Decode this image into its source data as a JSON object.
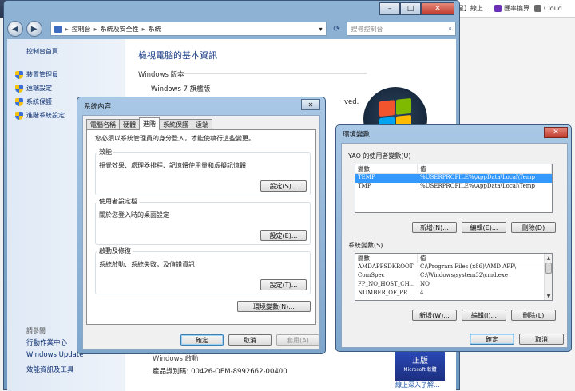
{
  "browser": {
    "bookmarks": [
      {
        "label": "星】線上…",
        "color": "#e05a1f"
      },
      {
        "label": "匯率換算",
        "color": "#6a2fb4"
      },
      {
        "label": "Cloud",
        "color": "#6a6a6a"
      }
    ]
  },
  "control_panel": {
    "breadcrumbs": [
      "控制台",
      "系統及安全性",
      "系統"
    ],
    "search_placeholder": "搜尋控制台",
    "sidebar": {
      "home": "控制台首頁",
      "items": [
        "裝置管理員",
        "遠端設定",
        "系統保護",
        "進階系統設定"
      ],
      "see_also_title": "請參閱",
      "see_also": [
        "行動作業中心",
        "Windows Update",
        "效能資訊及工具"
      ]
    },
    "main": {
      "title": "檢視電腦的基本資訊",
      "edition_heading": "Windows 版本",
      "edition": "Windows 7 旗艦版",
      "copyright_tail": "ved.",
      "activation_heading": "Windows 啟動",
      "product_id": "產品識別碼: 00426-OEM-8992662-00400",
      "genuine_label": "正版",
      "genuine_sub": "Microsoft 軟體",
      "genuine_link": "線上深入了解..."
    },
    "caption": {
      "minimize": "–",
      "maximize": "□",
      "close": "✕"
    }
  },
  "system_properties": {
    "title": "系統內容",
    "close": "✕",
    "tabs": [
      "電腦名稱",
      "硬體",
      "進階",
      "系統保護",
      "遠端"
    ],
    "active_tab": 2,
    "note": "您必須以系統管理員的身分登入，才能使執行這些變更。",
    "groups": [
      {
        "title": "效能",
        "text": "視覺效果、處理器排程、記憶體使用量和虛擬記憶體",
        "button": "設定(S)..."
      },
      {
        "title": "使用者設定檔",
        "text": "關於您登入時的桌面設定",
        "button": "設定(E)..."
      },
      {
        "title": "啟動及修復",
        "text": "系統啟動、系統失敗，及偵錯資訊",
        "button": "設定(T)..."
      }
    ],
    "env_button": "環境變數(N)...",
    "ok": "確定",
    "cancel": "取消",
    "apply": "套用(A)"
  },
  "env_vars": {
    "title": "環境變數",
    "close": "✕",
    "user_label": "YAO 的使用者變數(U)",
    "col_var": "變數",
    "col_val": "值",
    "user_rows": [
      {
        "name": "TEMP",
        "value": "%USERPROFILE%\\AppData\\Local\\Temp",
        "selected": true
      },
      {
        "name": "TMP",
        "value": "%USERPROFILE%\\AppData\\Local\\Temp",
        "selected": false
      }
    ],
    "user_buttons": [
      "新增(N)...",
      "編輯(E)...",
      "刪除(D)"
    ],
    "system_label": "系統變數(S)",
    "system_rows": [
      {
        "name": "AMDAPPSDKROOT",
        "value": "C:\\Program Files (x86)\\AMD APP\\"
      },
      {
        "name": "ComSpec",
        "value": "C:\\Windows\\system32\\cmd.exe"
      },
      {
        "name": "FP_NO_HOST_CH...",
        "value": "NO"
      },
      {
        "name": "NUMBER_OF_PR...",
        "value": "4"
      }
    ],
    "system_buttons": [
      "新增(W)...",
      "編輯(I)...",
      "刪除(L)"
    ],
    "ok": "確定",
    "cancel": "取消"
  },
  "colors": {
    "link": "#0b2e72",
    "selection": "#3399ff",
    "close_red": "#c0392b"
  }
}
